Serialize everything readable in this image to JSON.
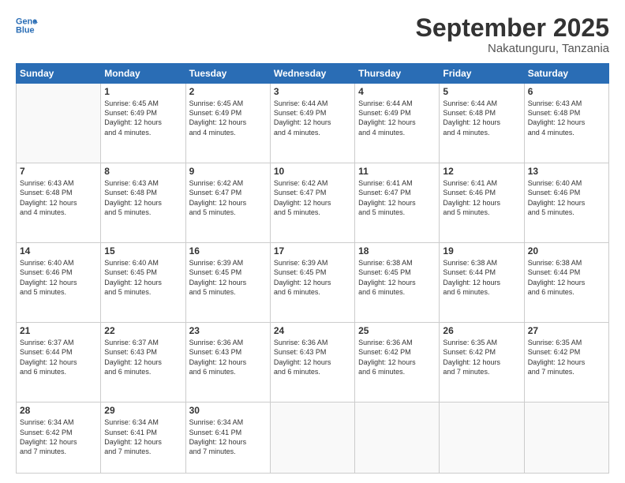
{
  "header": {
    "logo_line1": "General",
    "logo_line2": "Blue",
    "month": "September 2025",
    "location": "Nakatunguru, Tanzania"
  },
  "weekdays": [
    "Sunday",
    "Monday",
    "Tuesday",
    "Wednesday",
    "Thursday",
    "Friday",
    "Saturday"
  ],
  "weeks": [
    [
      {
        "day": "",
        "info": ""
      },
      {
        "day": "1",
        "info": "Sunrise: 6:45 AM\nSunset: 6:49 PM\nDaylight: 12 hours\nand 4 minutes."
      },
      {
        "day": "2",
        "info": "Sunrise: 6:45 AM\nSunset: 6:49 PM\nDaylight: 12 hours\nand 4 minutes."
      },
      {
        "day": "3",
        "info": "Sunrise: 6:44 AM\nSunset: 6:49 PM\nDaylight: 12 hours\nand 4 minutes."
      },
      {
        "day": "4",
        "info": "Sunrise: 6:44 AM\nSunset: 6:49 PM\nDaylight: 12 hours\nand 4 minutes."
      },
      {
        "day": "5",
        "info": "Sunrise: 6:44 AM\nSunset: 6:48 PM\nDaylight: 12 hours\nand 4 minutes."
      },
      {
        "day": "6",
        "info": "Sunrise: 6:43 AM\nSunset: 6:48 PM\nDaylight: 12 hours\nand 4 minutes."
      }
    ],
    [
      {
        "day": "7",
        "info": "Sunrise: 6:43 AM\nSunset: 6:48 PM\nDaylight: 12 hours\nand 4 minutes."
      },
      {
        "day": "8",
        "info": "Sunrise: 6:43 AM\nSunset: 6:48 PM\nDaylight: 12 hours\nand 5 minutes."
      },
      {
        "day": "9",
        "info": "Sunrise: 6:42 AM\nSunset: 6:47 PM\nDaylight: 12 hours\nand 5 minutes."
      },
      {
        "day": "10",
        "info": "Sunrise: 6:42 AM\nSunset: 6:47 PM\nDaylight: 12 hours\nand 5 minutes."
      },
      {
        "day": "11",
        "info": "Sunrise: 6:41 AM\nSunset: 6:47 PM\nDaylight: 12 hours\nand 5 minutes."
      },
      {
        "day": "12",
        "info": "Sunrise: 6:41 AM\nSunset: 6:46 PM\nDaylight: 12 hours\nand 5 minutes."
      },
      {
        "day": "13",
        "info": "Sunrise: 6:40 AM\nSunset: 6:46 PM\nDaylight: 12 hours\nand 5 minutes."
      }
    ],
    [
      {
        "day": "14",
        "info": "Sunrise: 6:40 AM\nSunset: 6:46 PM\nDaylight: 12 hours\nand 5 minutes."
      },
      {
        "day": "15",
        "info": "Sunrise: 6:40 AM\nSunset: 6:45 PM\nDaylight: 12 hours\nand 5 minutes."
      },
      {
        "day": "16",
        "info": "Sunrise: 6:39 AM\nSunset: 6:45 PM\nDaylight: 12 hours\nand 5 minutes."
      },
      {
        "day": "17",
        "info": "Sunrise: 6:39 AM\nSunset: 6:45 PM\nDaylight: 12 hours\nand 6 minutes."
      },
      {
        "day": "18",
        "info": "Sunrise: 6:38 AM\nSunset: 6:45 PM\nDaylight: 12 hours\nand 6 minutes."
      },
      {
        "day": "19",
        "info": "Sunrise: 6:38 AM\nSunset: 6:44 PM\nDaylight: 12 hours\nand 6 minutes."
      },
      {
        "day": "20",
        "info": "Sunrise: 6:38 AM\nSunset: 6:44 PM\nDaylight: 12 hours\nand 6 minutes."
      }
    ],
    [
      {
        "day": "21",
        "info": "Sunrise: 6:37 AM\nSunset: 6:44 PM\nDaylight: 12 hours\nand 6 minutes."
      },
      {
        "day": "22",
        "info": "Sunrise: 6:37 AM\nSunset: 6:43 PM\nDaylight: 12 hours\nand 6 minutes."
      },
      {
        "day": "23",
        "info": "Sunrise: 6:36 AM\nSunset: 6:43 PM\nDaylight: 12 hours\nand 6 minutes."
      },
      {
        "day": "24",
        "info": "Sunrise: 6:36 AM\nSunset: 6:43 PM\nDaylight: 12 hours\nand 6 minutes."
      },
      {
        "day": "25",
        "info": "Sunrise: 6:36 AM\nSunset: 6:42 PM\nDaylight: 12 hours\nand 6 minutes."
      },
      {
        "day": "26",
        "info": "Sunrise: 6:35 AM\nSunset: 6:42 PM\nDaylight: 12 hours\nand 7 minutes."
      },
      {
        "day": "27",
        "info": "Sunrise: 6:35 AM\nSunset: 6:42 PM\nDaylight: 12 hours\nand 7 minutes."
      }
    ],
    [
      {
        "day": "28",
        "info": "Sunrise: 6:34 AM\nSunset: 6:42 PM\nDaylight: 12 hours\nand 7 minutes."
      },
      {
        "day": "29",
        "info": "Sunrise: 6:34 AM\nSunset: 6:41 PM\nDaylight: 12 hours\nand 7 minutes."
      },
      {
        "day": "30",
        "info": "Sunrise: 6:34 AM\nSunset: 6:41 PM\nDaylight: 12 hours\nand 7 minutes."
      },
      {
        "day": "",
        "info": ""
      },
      {
        "day": "",
        "info": ""
      },
      {
        "day": "",
        "info": ""
      },
      {
        "day": "",
        "info": ""
      }
    ]
  ]
}
